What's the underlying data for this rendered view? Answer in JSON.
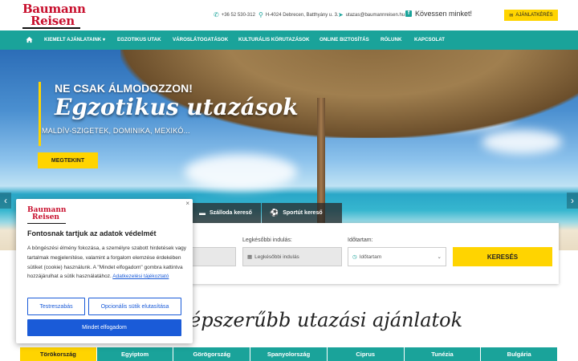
{
  "header": {
    "logo_line1": "Baumann",
    "logo_line2": "Reisen",
    "phone": "+36 52 530-312",
    "address": "H-4024 Debrecen, Batthyány u. 3.",
    "email": "utazas@baumannreisen.hu",
    "facebook_label": "Kövessen minket!",
    "offer_button": "AJÁNLATKÉRÉS"
  },
  "nav": {
    "items": [
      "KIEMELT AJÁNLATAINK",
      "EGZOTIKUS UTAK",
      "VÁROSLÁTOGATÁSOK",
      "KULTURÁLIS KÖRUTAZÁSOK",
      "ONLINE BIZTOSÍTÁS",
      "RÓLUNK",
      "KAPCSOLAT"
    ]
  },
  "hero": {
    "subtitle1": "NE CSAK ÁLMODOZZON!",
    "title": "Egzotikus utazások",
    "subtitle2": "MALDÍV-SZIGETEK, DOMINIKA, MEXIKÓ...",
    "button": "MEGTEKINT"
  },
  "search": {
    "tabs": [
      "Szálloda kereső",
      "Sportút kereső"
    ],
    "latest_label": "Legkésőbbi indulás:",
    "latest_placeholder": "Legkésőbbi indulás",
    "duration_label": "Időtartam:",
    "duration_value": "Időtartam",
    "button": "KERESÉS"
  },
  "section": {
    "title": "épszerűbb utazási ajánlatok"
  },
  "countries": [
    "Törökország",
    "Egyiptom",
    "Görögország",
    "Spanyolország",
    "Ciprus",
    "Tunézia",
    "Bulgária"
  ],
  "cookie": {
    "close": "×",
    "logo_line1": "Baumann",
    "logo_line2": "Reisen",
    "heading": "Fontosnak tartjuk az adatok védelmét",
    "text": "A böngészési élmény fokozása, a személyre szabott hirdetések vagy tartalmak megjelenítése, valamint a forgalom elemzése érdekében sütiket (cookie) használunk. A \"Mindet elfogadom\" gombra kattintva hozzájárulhat a sütik használatához.",
    "link": "Adatkezelési tájékoztató",
    "customize": "Testreszabás",
    "reject": "Opcionális sütik elutasítása",
    "accept": "Mindet elfogadom"
  },
  "colors": {
    "teal": "#1aa39a",
    "yellow": "#ffd400",
    "brand_red": "#c8102e",
    "cookie_blue": "#1a5bd8"
  }
}
